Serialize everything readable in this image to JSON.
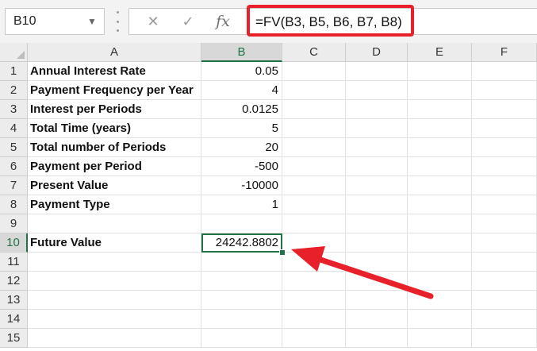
{
  "name_box": {
    "value": "B10"
  },
  "formula_bar": {
    "cancel_glyph": "✕",
    "enter_glyph": "✓",
    "fx_label": "fx",
    "formula": "=FV(B3, B5, B6, B7, B8)"
  },
  "sheet": {
    "columns": [
      "A",
      "B",
      "C",
      "D",
      "E",
      "F"
    ],
    "rows": [
      "1",
      "2",
      "3",
      "4",
      "5",
      "6",
      "7",
      "8",
      "9",
      "10",
      "11",
      "12",
      "13",
      "14",
      "15"
    ],
    "active_cell": "B10",
    "cells": [
      {
        "row": 1,
        "a": "Annual Interest Rate",
        "b": "0.05"
      },
      {
        "row": 2,
        "a": "Payment Frequency per Year",
        "b": "4"
      },
      {
        "row": 3,
        "a": "Interest per Periods",
        "b": "0.0125"
      },
      {
        "row": 4,
        "a": "Total Time (years)",
        "b": "5"
      },
      {
        "row": 5,
        "a": "Total number of Periods",
        "b": "20"
      },
      {
        "row": 6,
        "a": "Payment per Period",
        "b": "-500"
      },
      {
        "row": 7,
        "a": "Present Value",
        "b": "-10000"
      },
      {
        "row": 8,
        "a": "Payment Type",
        "b": "1"
      },
      {
        "row": 9,
        "a": "",
        "b": ""
      },
      {
        "row": 10,
        "a": "Future Value",
        "b": "24242.8802"
      },
      {
        "row": 11,
        "a": "",
        "b": ""
      },
      {
        "row": 12,
        "a": "",
        "b": ""
      },
      {
        "row": 13,
        "a": "",
        "b": ""
      },
      {
        "row": 14,
        "a": "",
        "b": ""
      },
      {
        "row": 15,
        "a": "",
        "b": ""
      }
    ]
  },
  "colors": {
    "highlight_red": "#e8202a",
    "excel_green": "#217346"
  }
}
